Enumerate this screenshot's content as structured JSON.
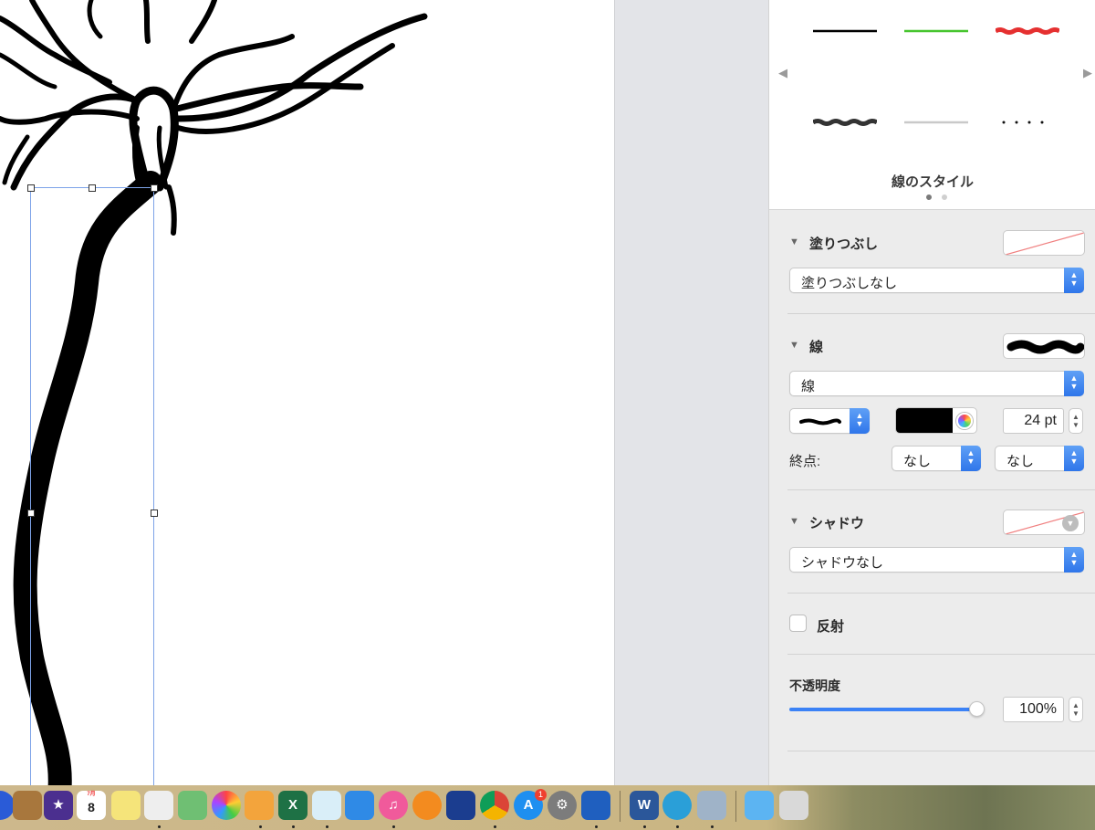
{
  "inspector": {
    "styles": {
      "title": "線のスタイル",
      "page_count": 2,
      "current_page": 1,
      "swatch_colors": [
        "#000000",
        "#47c52f",
        "#e53030",
        "#333333",
        "#c9c9c9",
        "#111111"
      ]
    },
    "fill": {
      "label": "塗りつぶし",
      "popup_value": "塗りつぶしなし"
    },
    "stroke": {
      "label": "線",
      "popup_value": "線",
      "color": "#000000",
      "width_value": "24 pt",
      "endpoints_label": "終点:",
      "start_end": "なし",
      "finish_end": "なし"
    },
    "shadow": {
      "label": "シャドウ",
      "popup_value": "シャドウなし"
    },
    "reflection": {
      "label": "反射",
      "checked": false
    },
    "opacity": {
      "label": "不透明度",
      "value": "100%",
      "slider_fraction": 1.0
    }
  },
  "dock": {
    "calendar_day": "8",
    "calendar_month": "7月",
    "app_store_badge": "1",
    "word_letter": "W",
    "excel_letter": "X",
    "accent_color": "#2f76ea"
  }
}
